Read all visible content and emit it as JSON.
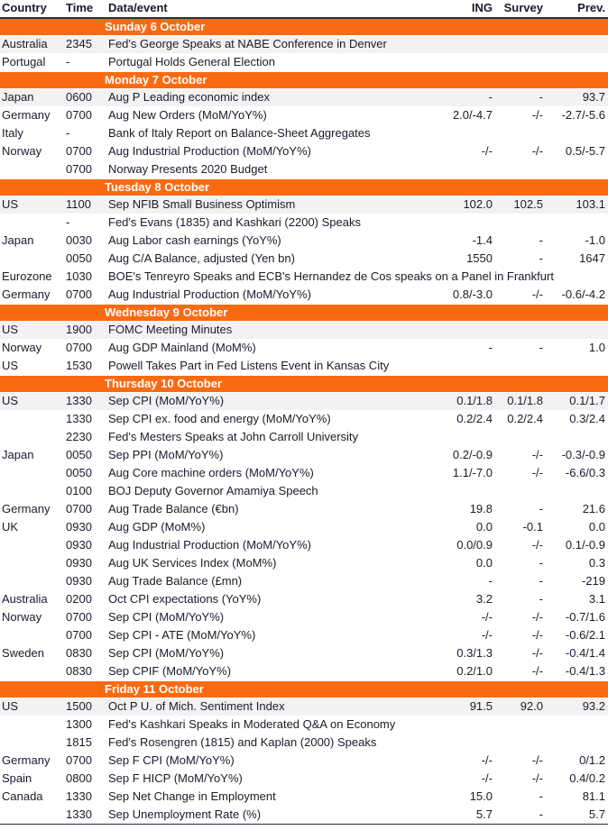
{
  "table": {
    "columns": [
      "Country",
      "Time",
      "Data/event",
      "ING",
      "Survey",
      "Prev."
    ],
    "sections": [
      {
        "day": "Sunday 6 October",
        "rows": [
          {
            "country": "Australia",
            "time": "2345",
            "event": "Fed's George Speaks at NABE Conference in Denver",
            "ing": "",
            "survey": "",
            "prev": ""
          },
          {
            "country": "Portugal",
            "time": "-",
            "event": "Portugal Holds General Election",
            "ing": "",
            "survey": "",
            "prev": ""
          }
        ]
      },
      {
        "day": "Monday 7 October",
        "rows": [
          {
            "country": "Japan",
            "time": "0600",
            "event": "Aug P Leading economic index",
            "ing": "-",
            "survey": "-",
            "prev": "93.7"
          },
          {
            "country": "Germany",
            "time": "0700",
            "event": "Aug New Orders (MoM/YoY%)",
            "ing": "2.0/-4.7",
            "survey": "-/-",
            "prev": "-2.7/-5.6"
          },
          {
            "country": "Italy",
            "time": "-",
            "event": "Bank of Italy Report on Balance-Sheet Aggregates",
            "ing": "",
            "survey": "",
            "prev": ""
          },
          {
            "country": "Norway",
            "time": "0700",
            "event": "Aug Industrial Production (MoM/YoY%)",
            "ing": "-/-",
            "survey": "-/-",
            "prev": "0.5/-5.7"
          },
          {
            "country": "",
            "time": "0700",
            "event": "Norway Presents 2020 Budget",
            "ing": "",
            "survey": "",
            "prev": ""
          }
        ]
      },
      {
        "day": "Tuesday 8 October",
        "rows": [
          {
            "country": "US",
            "time": "1100",
            "event": "Sep NFIB Small Business Optimism",
            "ing": "102.0",
            "survey": "102.5",
            "prev": "103.1"
          },
          {
            "country": "",
            "time": "-",
            "event": "Fed's Evans (1835) and Kashkari (2200) Speaks",
            "ing": "",
            "survey": "",
            "prev": ""
          },
          {
            "country": "Japan",
            "time": "0030",
            "event": "Aug Labor cash earnings (YoY%)",
            "ing": "-1.4",
            "survey": "-",
            "prev": "-1.0"
          },
          {
            "country": "",
            "time": "0050",
            "event": "Aug C/A Balance, adjusted (Yen bn)",
            "ing": "1550",
            "survey": "-",
            "prev": "1647"
          },
          {
            "country": "Eurozone",
            "time": "1030",
            "event": "BOE's Tenreyro Speaks and ECB's Hernandez de Cos speaks on a Panel in Frankfurt",
            "ing": "",
            "survey": "",
            "prev": ""
          },
          {
            "country": "Germany",
            "time": "0700",
            "event": "Aug Industrial Production (MoM/YoY%)",
            "ing": "0.8/-3.0",
            "survey": "-/-",
            "prev": "-0.6/-4.2"
          }
        ]
      },
      {
        "day": "Wednesday 9 October",
        "rows": [
          {
            "country": "US",
            "time": "1900",
            "event": "FOMC Meeting Minutes",
            "ing": "",
            "survey": "",
            "prev": ""
          },
          {
            "country": "Norway",
            "time": "0700",
            "event": "Aug GDP Mainland (MoM%)",
            "ing": "-",
            "survey": "-",
            "prev": "1.0"
          },
          {
            "country": "US",
            "time": "1530",
            "event": "Powell Takes Part in Fed Listens Event in Kansas City",
            "ing": "",
            "survey": "",
            "prev": ""
          }
        ]
      },
      {
        "day": "Thursday 10 October",
        "rows": [
          {
            "country": "US",
            "time": "1330",
            "event": "Sep CPI (MoM/YoY%)",
            "ing": "0.1/1.8",
            "survey": "0.1/1.8",
            "prev": "0.1/1.7"
          },
          {
            "country": "",
            "time": "1330",
            "event": "Sep CPI ex. food and energy (MoM/YoY%)",
            "ing": "0.2/2.4",
            "survey": "0.2/2.4",
            "prev": "0.3/2.4"
          },
          {
            "country": "",
            "time": "2230",
            "event": "Fed's Mesters Speaks at John Carroll University",
            "ing": "",
            "survey": "",
            "prev": ""
          },
          {
            "country": "Japan",
            "time": "0050",
            "event": "Sep PPI (MoM/YoY%)",
            "ing": "0.2/-0.9",
            "survey": "-/-",
            "prev": "-0.3/-0.9"
          },
          {
            "country": "",
            "time": "0050",
            "event": "Aug Core machine orders (MoM/YoY%)",
            "ing": "1.1/-7.0",
            "survey": "-/-",
            "prev": "-6.6/0.3"
          },
          {
            "country": "",
            "time": "0100",
            "event": "BOJ Deputy Governor Amamiya Speech",
            "ing": "",
            "survey": "",
            "prev": ""
          },
          {
            "country": "Germany",
            "time": "0700",
            "event": "Aug Trade Balance (€bn)",
            "ing": "19.8",
            "survey": "-",
            "prev": "21.6"
          },
          {
            "country": "UK",
            "time": "0930",
            "event": "Aug GDP (MoM%)",
            "ing": "0.0",
            "survey": "-0.1",
            "prev": "0.0"
          },
          {
            "country": "",
            "time": "0930",
            "event": "Aug Industrial Production (MoM/YoY%)",
            "ing": "0.0/0.9",
            "survey": "-/-",
            "prev": "0.1/-0.9"
          },
          {
            "country": "",
            "time": "0930",
            "event": "Aug UK Services Index (MoM%)",
            "ing": "0.0",
            "survey": "-",
            "prev": "0.3"
          },
          {
            "country": "",
            "time": "0930",
            "event": "Aug Trade Balance (£mn)",
            "ing": "-",
            "survey": "-",
            "prev": "-219"
          },
          {
            "country": "Australia",
            "time": "0200",
            "event": "Oct CPI expectations (YoY%)",
            "ing": "3.2",
            "survey": "-",
            "prev": "3.1"
          },
          {
            "country": "Norway",
            "time": "0700",
            "event": "Sep CPI (MoM/YoY%)",
            "ing": "-/-",
            "survey": "-/-",
            "prev": "-0.7/1.6"
          },
          {
            "country": "",
            "time": "0700",
            "event": "Sep CPI - ATE (MoM/YoY%)",
            "ing": "-/-",
            "survey": "-/-",
            "prev": "-0.6/2.1"
          },
          {
            "country": "Sweden",
            "time": "0830",
            "event": "Sep CPI (MoM/YoY%)",
            "ing": "0.3/1.3",
            "survey": "-/-",
            "prev": "-0.4/1.4"
          },
          {
            "country": "",
            "time": "0830",
            "event": "Sep CPIF (MoM/YoY%)",
            "ing": "0.2/1.0",
            "survey": "-/-",
            "prev": "-0.4/1.3"
          }
        ]
      },
      {
        "day": "Friday 11 October",
        "rows": [
          {
            "country": "US",
            "time": "1500",
            "event": "Oct P U. of Mich. Sentiment Index",
            "ing": "91.5",
            "survey": "92.0",
            "prev": "93.2"
          },
          {
            "country": "",
            "time": "1300",
            "event": "Fed's Kashkari Speaks in Moderated Q&A on Economy",
            "ing": "",
            "survey": "",
            "prev": ""
          },
          {
            "country": "",
            "time": "1815",
            "event": "Fed's Rosengren (1815) and Kaplan (2000) Speaks",
            "ing": "",
            "survey": "",
            "prev": ""
          },
          {
            "country": "Germany",
            "time": "0700",
            "event": "Sep F CPI (MoM/YoY%)",
            "ing": "-/-",
            "survey": "-/-",
            "prev": "0/1.2"
          },
          {
            "country": "Spain",
            "time": "0800",
            "event": "Sep F HICP (MoM/YoY%)",
            "ing": "-/-",
            "survey": "-/-",
            "prev": "0.4/0.2"
          },
          {
            "country": "Canada",
            "time": "1330",
            "event": "Sep Net Change in Employment",
            "ing": "15.0",
            "survey": "-",
            "prev": "81.1"
          },
          {
            "country": "",
            "time": "1330",
            "event": "Sep Unemployment Rate (%)",
            "ing": "5.7",
            "survey": "-",
            "prev": "5.7"
          }
        ]
      }
    ]
  },
  "colors": {
    "day_bar": "#F96A13",
    "shaded_row": "#f2f2f2",
    "text": "#1a1a2e"
  }
}
